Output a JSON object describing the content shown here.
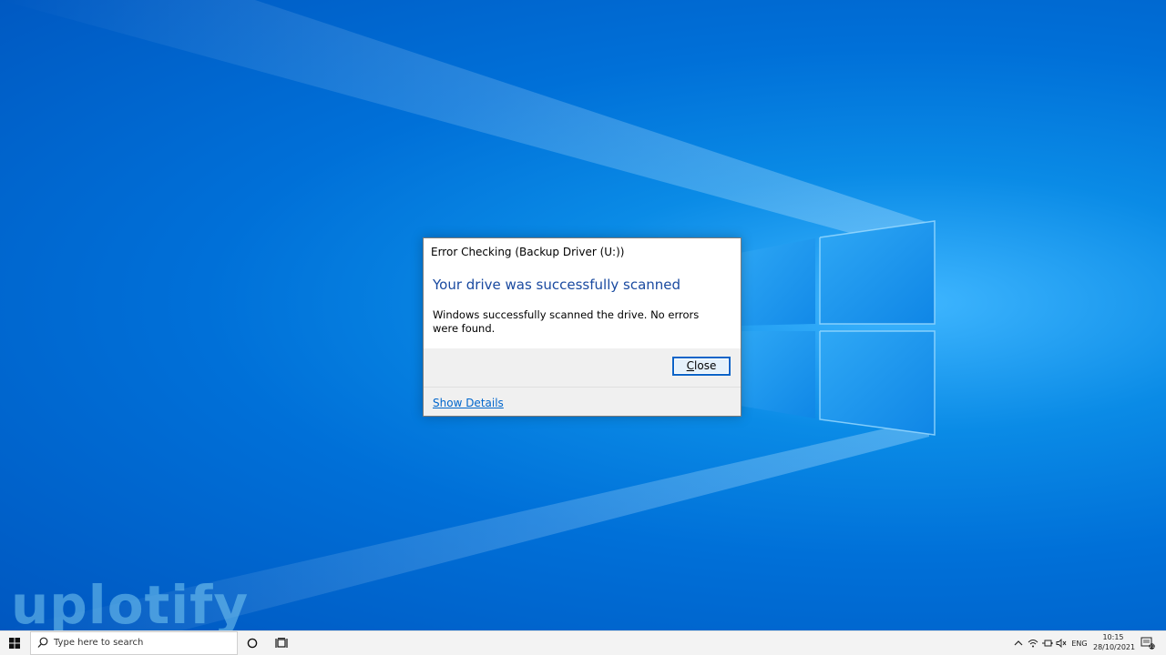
{
  "dialog": {
    "title": "Error Checking (Backup Driver (U:))",
    "heading": "Your drive was successfully scanned",
    "message": "Windows successfully scanned the drive. No errors were found.",
    "close_label_first": "C",
    "close_label_rest": "lose",
    "show_details_label": "Show Details"
  },
  "watermark": {
    "text": "uplotify"
  },
  "taskbar": {
    "search_placeholder": "Type here to search",
    "language": "ENG",
    "time": "10:15",
    "date": "28/10/2021",
    "notification_count": "21"
  },
  "colors": {
    "accent": "#0a64c8",
    "heading": "#1a4aa0",
    "link": "#0066cc",
    "desktop": "#0078d7"
  }
}
